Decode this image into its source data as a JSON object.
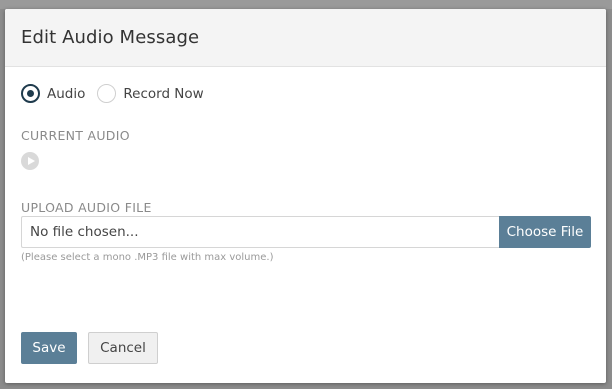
{
  "modal": {
    "title": "Edit Audio Message"
  },
  "radio_options": [
    {
      "label": "Audio",
      "checked": true
    },
    {
      "label": "Record Now",
      "checked": false
    }
  ],
  "current_audio": {
    "label": "CURRENT AUDIO",
    "icon": "play-icon"
  },
  "upload": {
    "label": "UPLOAD AUDIO FILE",
    "file_value": "No file chosen...",
    "choose_button": "Choose File",
    "hint": "(Please select a mono .MP3 file with max volume.)"
  },
  "footer": {
    "save_label": "Save",
    "cancel_label": "Cancel"
  },
  "colors": {
    "accent": "#5b7f97",
    "radio_checked": "#1f3b4d"
  }
}
